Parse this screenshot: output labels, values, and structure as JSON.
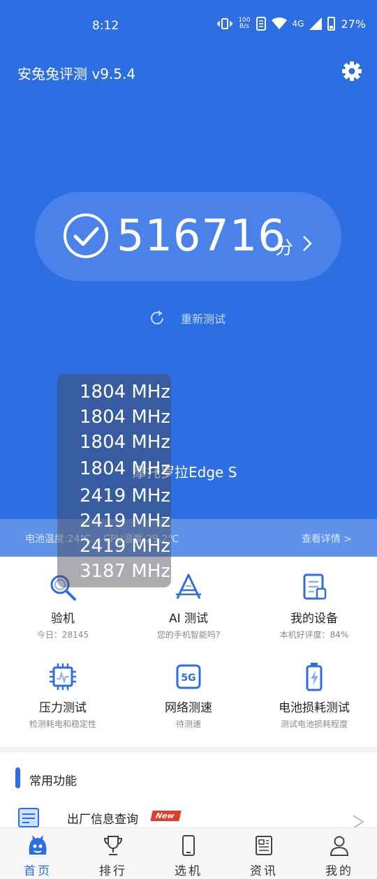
{
  "status_bar": {
    "time": "8:12",
    "net_speed_value": "100",
    "net_speed_unit": "B/s",
    "network": "4G",
    "battery": "27%"
  },
  "app": {
    "title": "安兔兔评测 v9.5.4"
  },
  "score": {
    "value": "516716",
    "unit": "分",
    "retest_label": "重新测试"
  },
  "device": {
    "name": "摩托罗拉Edge S",
    "battery_temp": "电池温度:24℃",
    "cpu_temp": "CPU温度:29.2℃",
    "details_link": "查看详情 >"
  },
  "cpu_freqs": [
    "1804 MHz",
    "1804 MHz",
    "1804 MHz",
    "1804 MHz",
    "2419 MHz",
    "2419 MHz",
    "2419 MHz",
    "3187 MHz"
  ],
  "functions": [
    {
      "title": "验机",
      "subtitle": "今日：28145"
    },
    {
      "title": "AI 测试",
      "subtitle": "您的手机智能吗?"
    },
    {
      "title": "我的设备",
      "subtitle": "本机好评度：84%"
    },
    {
      "title": "压力测试",
      "subtitle": "检测耗电和稳定性"
    },
    {
      "title": "网络测速",
      "subtitle": "待测速"
    },
    {
      "title": "电池损耗测试",
      "subtitle": "测试电池损耗程度"
    }
  ],
  "common": {
    "title": "常用功能",
    "first_item": "出厂信息查询",
    "new_badge": "New"
  },
  "nav": [
    {
      "label": "首页",
      "active": true
    },
    {
      "label": "排行"
    },
    {
      "label": "选机"
    },
    {
      "label": "资讯"
    },
    {
      "label": "我的"
    }
  ],
  "colors": {
    "brand_blue": "#2d6ee3",
    "badge_red": "#e33b2f"
  },
  "icons": {
    "settings": "gear-icon",
    "score_check": "check-circle-icon",
    "retest": "refresh-icon"
  }
}
